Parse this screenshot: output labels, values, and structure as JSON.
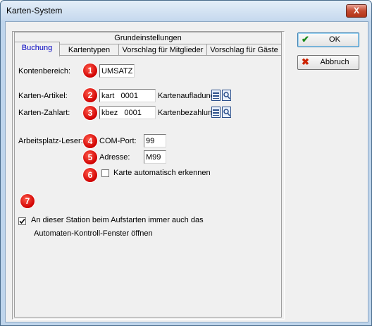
{
  "window": {
    "title": "Karten-System",
    "close_label": "X"
  },
  "header": {
    "group_label": "Grundeinstellungen"
  },
  "tabs": [
    {
      "label": "Buchung"
    },
    {
      "label": "Kartentypen"
    },
    {
      "label": "Vorschlag für Mitglieder"
    },
    {
      "label": "Vorschlag für Gäste"
    }
  ],
  "form": {
    "kontenbereich": {
      "label": "Kontenbereich:",
      "value": "UMSATZ",
      "badge": "1"
    },
    "karten_artikel": {
      "label": "Karten-Artikel:",
      "value": "kart   0001",
      "suffix": "Kartenaufladung",
      "badge": "2"
    },
    "karten_zahlart": {
      "label": "Karten-Zahlart:",
      "value": "kbez   0001",
      "suffix": "Kartenbezahlung",
      "badge": "3"
    },
    "arbeitsplatz": {
      "label": "Arbeitsplatz-Leser:"
    },
    "com_port": {
      "label": "COM-Port:",
      "value": "99",
      "badge": "4"
    },
    "adresse": {
      "label": "Adresse:",
      "value": "M99",
      "badge": "5"
    },
    "auto_detect": {
      "label": "Karte automatisch erkennen",
      "checked": false,
      "badge": "6"
    },
    "station": {
      "line1": "An dieser Station beim Aufstarten immer auch das",
      "line2": "Automaten-Kontroll-Fenster öffnen",
      "checked": true,
      "badge": "7"
    }
  },
  "buttons": {
    "ok": {
      "label": "OK",
      "icon": "check-icon"
    },
    "abbruch": {
      "label": "Abbruch",
      "icon": "cross-icon"
    }
  },
  "colors": {
    "badge": "#d00000",
    "tab_active_text": "#0000c0",
    "ok_icon": "#1a8a1a",
    "cancel_icon": "#cc2200"
  }
}
